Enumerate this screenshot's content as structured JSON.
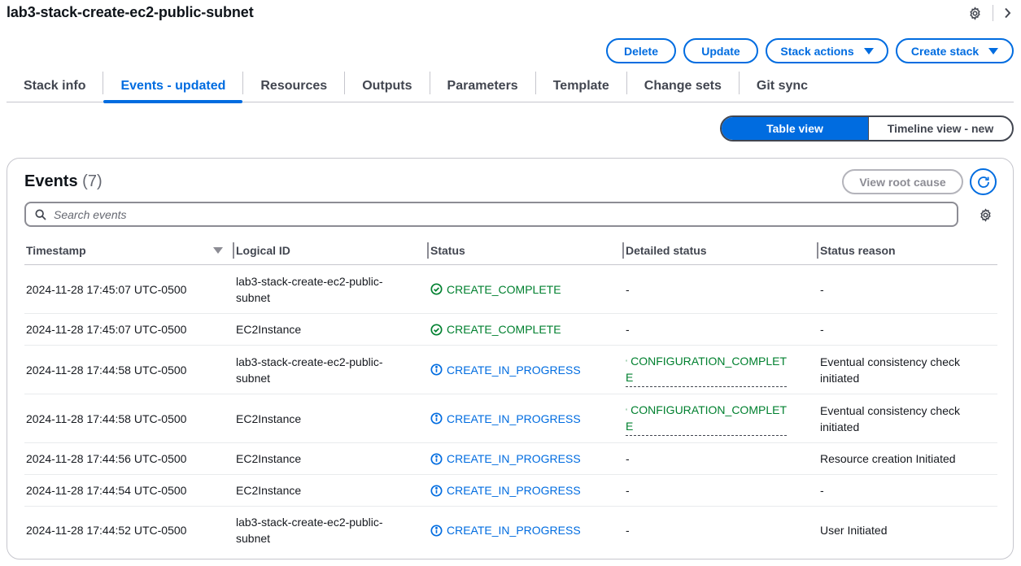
{
  "page": {
    "title": "lab3-stack-create-ec2-public-subnet"
  },
  "actions": {
    "delete": "Delete",
    "update": "Update",
    "stack_actions": "Stack actions",
    "create_stack": "Create stack"
  },
  "tabs": [
    "Stack info",
    "Events - updated",
    "Resources",
    "Outputs",
    "Parameters",
    "Template",
    "Change sets",
    "Git sync"
  ],
  "view_toggle": {
    "table": "Table view",
    "timeline": "Timeline view - new"
  },
  "events": {
    "title": "Events",
    "count": "(7)",
    "view_root_cause": "View root cause",
    "search_placeholder": "Search events",
    "columns": [
      "Timestamp",
      "Logical ID",
      "Status",
      "Detailed status",
      "Status reason"
    ],
    "rows": [
      {
        "timestamp": "2024-11-28 17:45:07 UTC-0500",
        "logical_id_1": "lab3-stack-create-ec2-public-",
        "logical_id_2": "subnet",
        "status": "CREATE_COMPLETE",
        "detail": "-",
        "reason_1": "-",
        "reason_2": ""
      },
      {
        "timestamp": "2024-11-28 17:45:07 UTC-0500",
        "logical_id_1": "EC2Instance",
        "logical_id_2": "",
        "status": "CREATE_COMPLETE",
        "detail": "-",
        "reason_1": "-",
        "reason_2": ""
      },
      {
        "timestamp": "2024-11-28 17:44:58 UTC-0500",
        "logical_id_1": "lab3-stack-create-ec2-public-",
        "logical_id_2": "subnet",
        "status": "CREATE_IN_PROGRESS",
        "detail_1": "CONFIGURATION_COMPLET",
        "detail_2": "E",
        "reason_1": "Eventual consistency check",
        "reason_2": "initiated"
      },
      {
        "timestamp": "2024-11-28 17:44:58 UTC-0500",
        "logical_id_1": "EC2Instance",
        "logical_id_2": "",
        "status": "CREATE_IN_PROGRESS",
        "detail_1": "CONFIGURATION_COMPLET",
        "detail_2": "E",
        "reason_1": "Eventual consistency check",
        "reason_2": "initiated"
      },
      {
        "timestamp": "2024-11-28 17:44:56 UTC-0500",
        "logical_id_1": "EC2Instance",
        "logical_id_2": "",
        "status": "CREATE_IN_PROGRESS",
        "detail": "-",
        "reason_1": "Resource creation Initiated",
        "reason_2": ""
      },
      {
        "timestamp": "2024-11-28 17:44:54 UTC-0500",
        "logical_id_1": "EC2Instance",
        "logical_id_2": "",
        "status": "CREATE_IN_PROGRESS",
        "detail": "-",
        "reason_1": "-",
        "reason_2": ""
      },
      {
        "timestamp": "2024-11-28 17:44:52 UTC-0500",
        "logical_id_1": "lab3-stack-create-ec2-public-",
        "logical_id_2": "subnet",
        "status": "CREATE_IN_PROGRESS",
        "detail": "-",
        "reason_1": "User Initiated",
        "reason_2": ""
      }
    ]
  },
  "colors": {
    "accent": "#006ce0",
    "success": "#00802f",
    "text": "#16191f",
    "muted": "#424650"
  }
}
